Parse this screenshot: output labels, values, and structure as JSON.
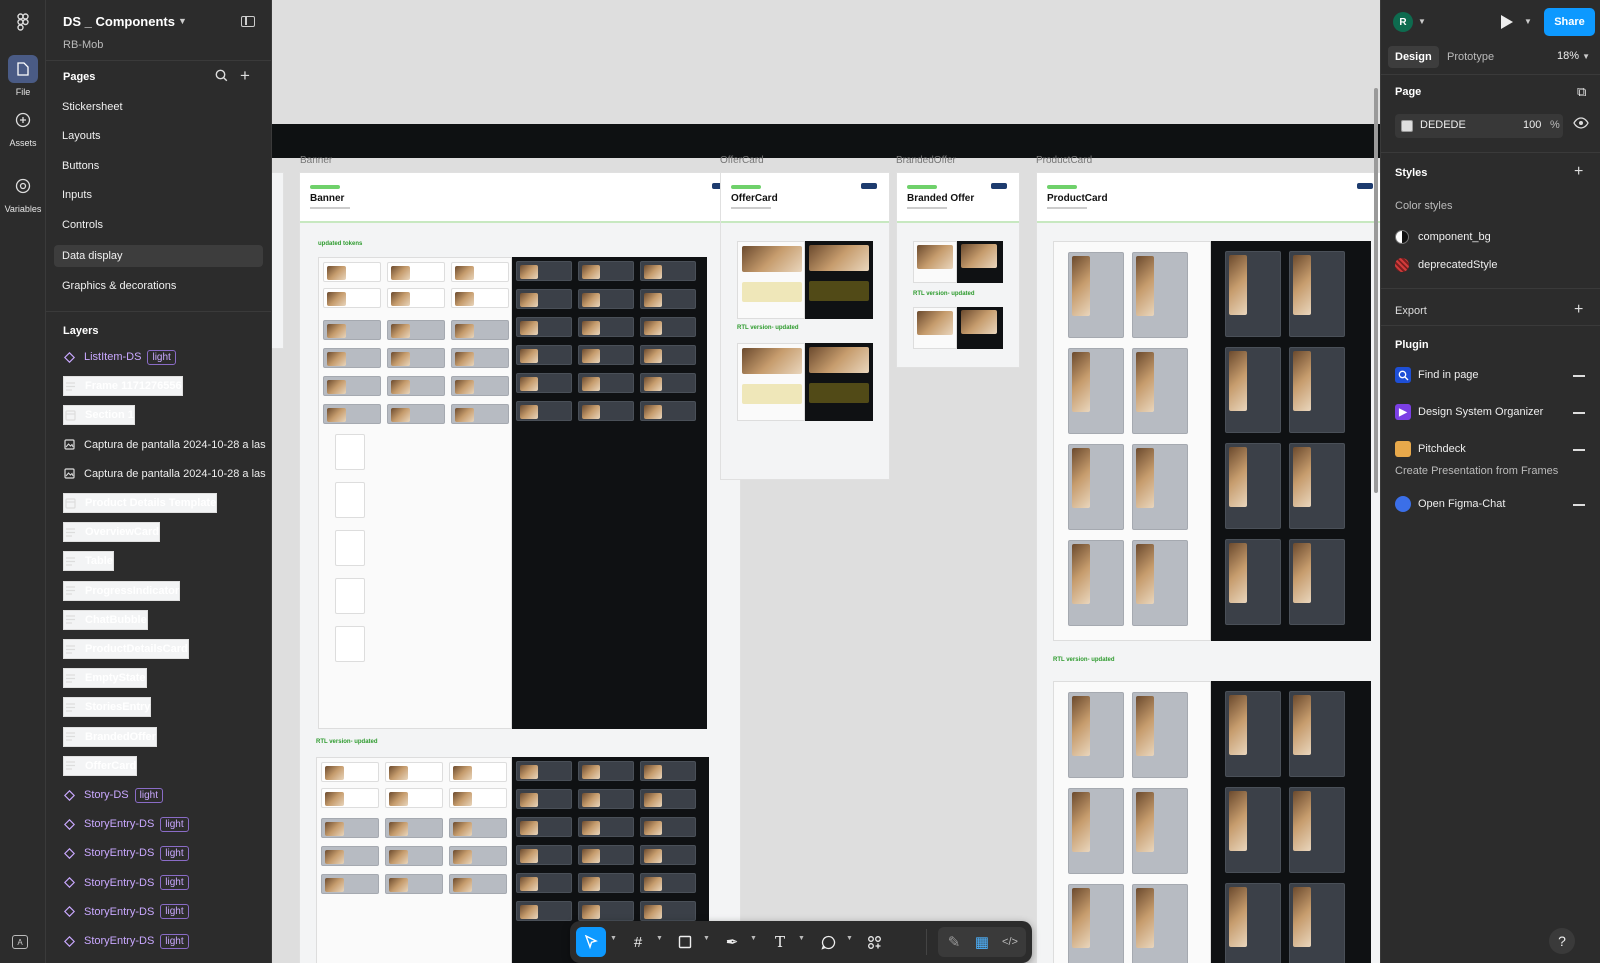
{
  "file": {
    "title": "DS _ Components",
    "subtitle": "RB-Mob"
  },
  "rail": {
    "file_label": "File",
    "assets_label": "Assets",
    "variables_label": "Variables"
  },
  "pages": {
    "header": "Pages",
    "items": [
      {
        "label": "Stickersheet"
      },
      {
        "label": "Layouts"
      },
      {
        "label": "Buttons"
      },
      {
        "label": "Inputs"
      },
      {
        "label": "Controls"
      },
      {
        "label": "Data display"
      },
      {
        "label": "Graphics & decorations"
      }
    ],
    "active_index": 5
  },
  "layers": {
    "header": "Layers",
    "items": [
      {
        "label": "ListItem-DS",
        "badge": "light",
        "kind": "component"
      },
      {
        "label": "Frame 1171276556",
        "kind": "frame"
      },
      {
        "label": "Section 1",
        "kind": "section"
      },
      {
        "label": "Captura de pantalla 2024-10-28 a las",
        "kind": "image"
      },
      {
        "label": "Captura de pantalla 2024-10-28 a las",
        "kind": "image"
      },
      {
        "label": "Product Details Template",
        "kind": "section"
      },
      {
        "label": "OverviewCard",
        "kind": "frame"
      },
      {
        "label": "Table",
        "kind": "frame"
      },
      {
        "label": "ProgressIndicator",
        "kind": "frame"
      },
      {
        "label": "ChatBubble",
        "kind": "frame"
      },
      {
        "label": "ProductDetailsCard",
        "kind": "frame"
      },
      {
        "label": "EmptyState",
        "kind": "frame"
      },
      {
        "label": "StoriesEntry",
        "kind": "frame"
      },
      {
        "label": "BrandedOffer",
        "kind": "frame"
      },
      {
        "label": "OfferCard",
        "kind": "frame"
      },
      {
        "label": "Story-DS",
        "badge": "light",
        "kind": "component"
      },
      {
        "label": "StoryEntry-DS",
        "badge": "light",
        "kind": "component"
      },
      {
        "label": "StoryEntry-DS",
        "badge": "light",
        "kind": "component"
      },
      {
        "label": "StoryEntry-DS",
        "badge": "light",
        "kind": "component"
      },
      {
        "label": "StoryEntry-DS",
        "badge": "light",
        "kind": "component"
      },
      {
        "label": "StoryEntry-DS",
        "badge": "light",
        "kind": "component"
      }
    ]
  },
  "canvas": {
    "frames": [
      {
        "label": "Banner",
        "title": "Banner"
      },
      {
        "label": "OfferCard",
        "title": "OfferCard"
      },
      {
        "label": "BrandedOffer",
        "title": "Branded Offer"
      },
      {
        "label": "ProductCard",
        "title": "ProductCard"
      }
    ],
    "notes": {
      "updated_tokens": "updated tokens",
      "rtl_updated": "RTL version- updated",
      "rtl_updated_offer": "RTL version- updated",
      "rtl_updated_branded": "RTL version- updated",
      "rtl_updated_product": "RTL version- updated"
    }
  },
  "toolbar": {
    "tools": [
      "move-tool",
      "frame-tool",
      "shape-tool",
      "pen-tool",
      "text-tool",
      "comment-tool",
      "actions-tool",
      "draw-mode",
      "design-mode",
      "dev-mode"
    ]
  },
  "right": {
    "avatar_initial": "R",
    "share_label": "Share",
    "tabs": {
      "design": "Design",
      "prototype": "Prototype"
    },
    "zoom": "18%",
    "page": {
      "header": "Page",
      "color_hex": "DEDEDE",
      "opacity": "100",
      "opacity_unit": "%"
    },
    "styles": {
      "header": "Styles",
      "subheader": "Color styles",
      "items": [
        "component_bg",
        "deprecatedStyle"
      ]
    },
    "export_header": "Export",
    "plugin": {
      "header": "Plugin",
      "items": [
        {
          "name": "Find in page",
          "color": "#1e4fd6"
        },
        {
          "name": "Design System Organizer",
          "color": "#7b3fe4"
        },
        {
          "name": "Pitchdeck",
          "color": "#e8a94b",
          "description": "Create Presentation from Frames"
        },
        {
          "name": "Open Figma-Chat",
          "color": "#3b6fe8"
        }
      ]
    }
  },
  "colors": {
    "accent": "#0d99ff",
    "canvas_bg": "#dedede",
    "panel_bg": "#2c2c2c",
    "component_purple": "#c9a8ff"
  }
}
